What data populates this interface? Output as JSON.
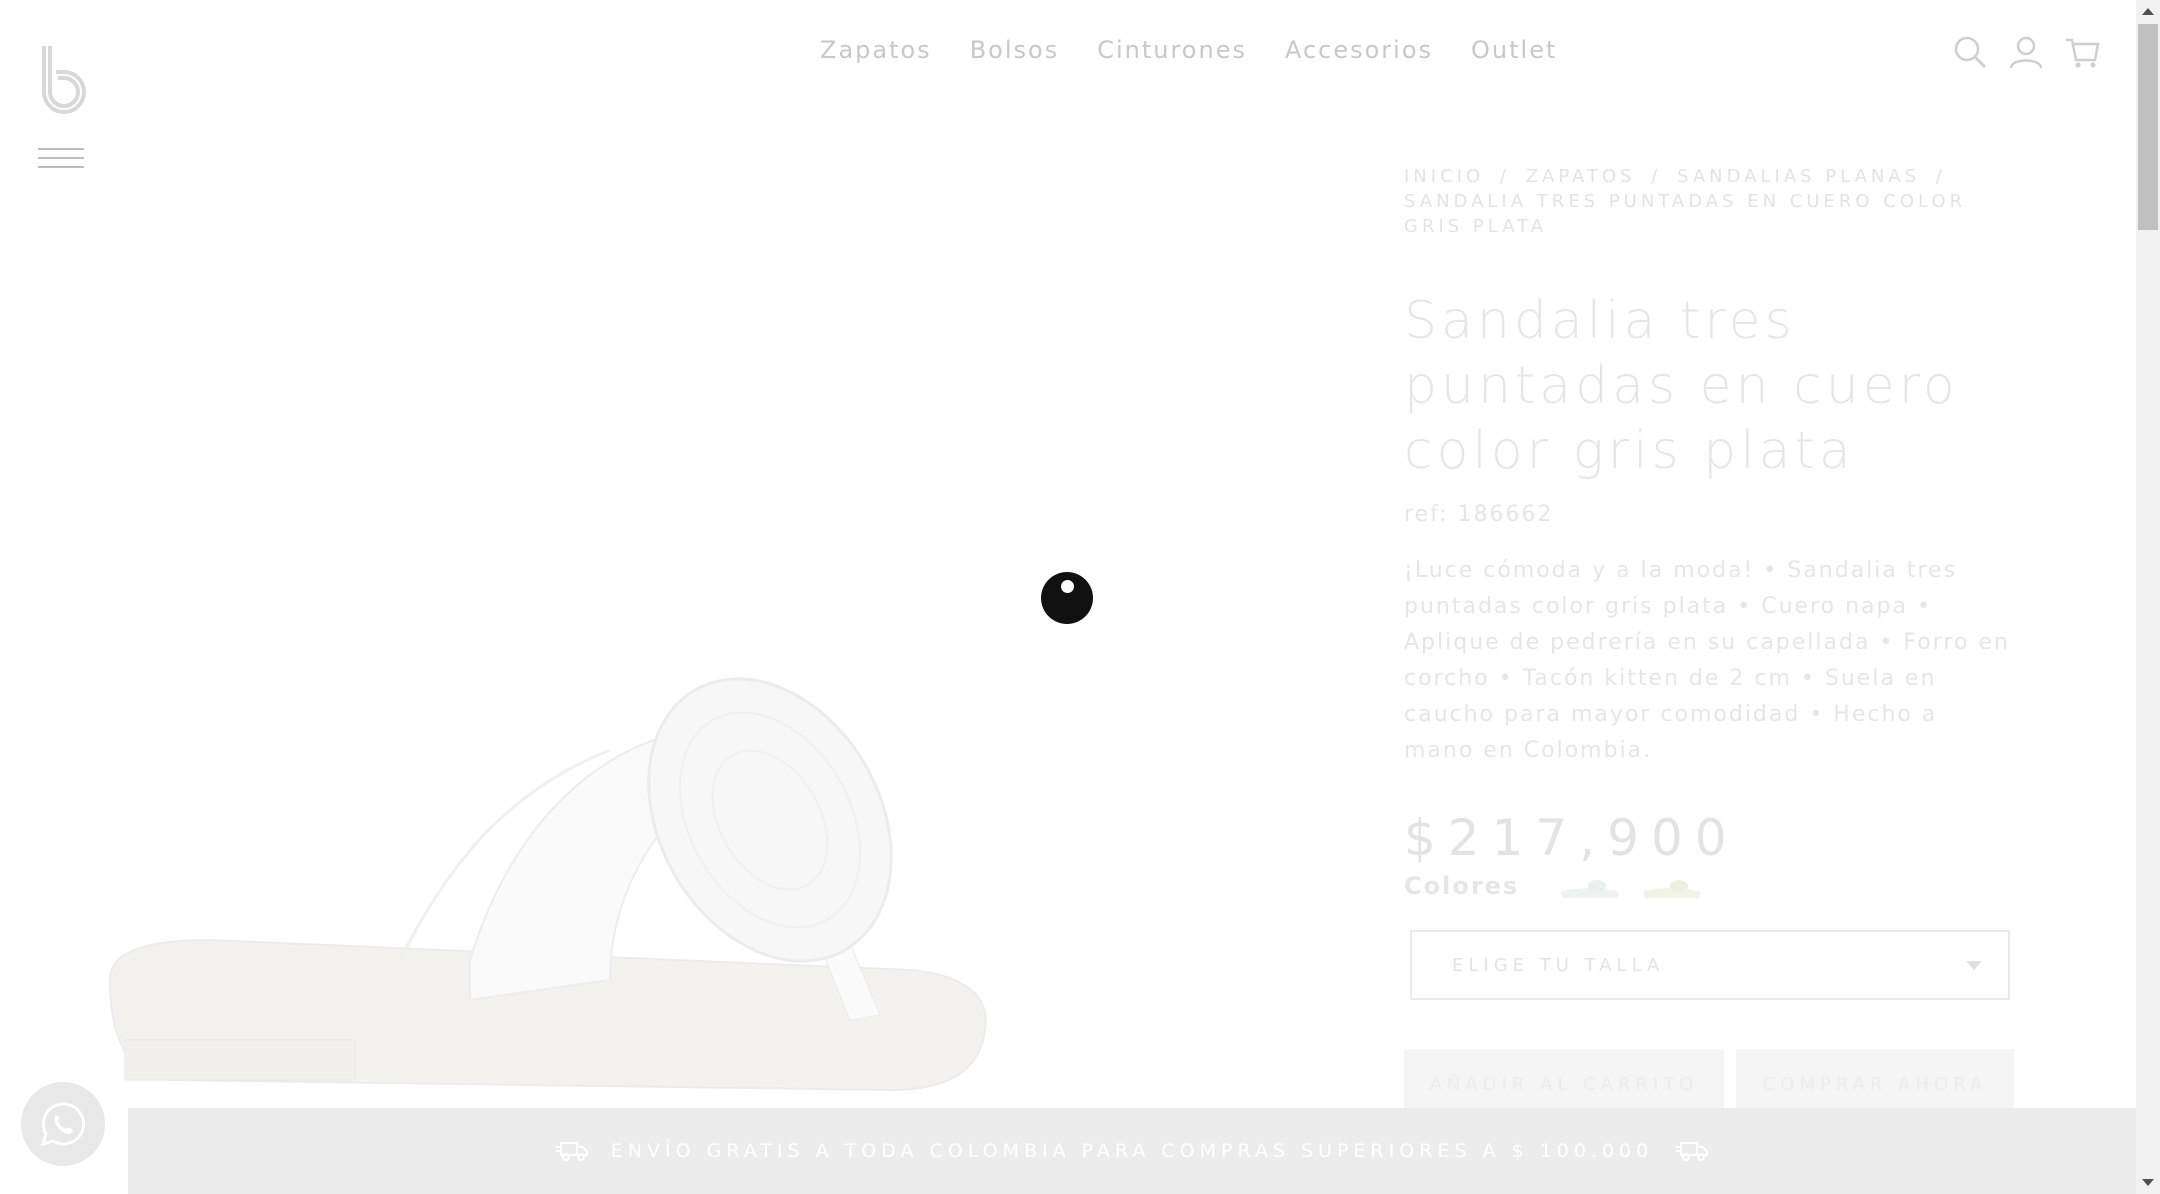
{
  "header": {
    "nav": [
      {
        "label": "Zapatos"
      },
      {
        "label": "Bolsos"
      },
      {
        "label": "Cinturones"
      },
      {
        "label": "Accesorios"
      },
      {
        "label": "Outlet"
      }
    ],
    "icons": [
      "search-icon",
      "user-icon",
      "cart-icon"
    ]
  },
  "product": {
    "breadcrumb": [
      "INICIO",
      "/",
      "ZAPATOS",
      "/",
      "SANDALIAS PLANAS",
      "/",
      "SANDALIA TRES PUNTADAS EN CUERO COLOR GRIS PLATA"
    ],
    "title": "Sandalia tres puntadas en cuero color gris plata",
    "ref": "ref: 186662",
    "description": "¡Luce cómoda y a la moda! • Sandalia tres puntadas color gris plata • Cuero napa • Aplique de pedrería en su capellada • Forro en corcho • Tacón kitten de 2 cm • Suela en caucho para mayor comodidad • Hecho a mano en Colombia.",
    "price": "$217,900",
    "colors_label": "Colores",
    "size_placeholder": "ELIGE TU TALLA",
    "add_to_cart": "AÑADIR AL CARRITO",
    "buy_now": "COMPRAR AHORA"
  },
  "banner": {
    "text": "ENVÍO GRATIS A TODA COLOMBIA PARA COMPRAS SUPERIORES A $ 100.000"
  },
  "colors": {
    "text_light": "#e6e6e6",
    "banner_bg": "#ececec"
  }
}
